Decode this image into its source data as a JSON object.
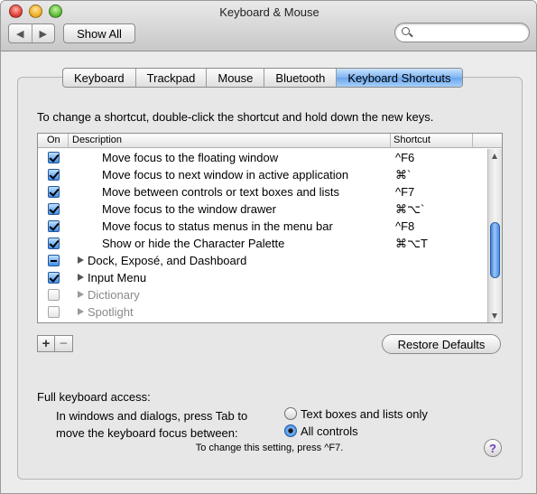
{
  "window": {
    "title": "Keyboard & Mouse"
  },
  "toolbar": {
    "back_glyph": "◀",
    "forward_glyph": "▶",
    "show_all_label": "Show All",
    "search_value": ""
  },
  "tabs": [
    {
      "label": "Keyboard",
      "active": false
    },
    {
      "label": "Trackpad",
      "active": false
    },
    {
      "label": "Mouse",
      "active": false
    },
    {
      "label": "Bluetooth",
      "active": false
    },
    {
      "label": "Keyboard Shortcuts",
      "active": true
    }
  ],
  "instruction": "To change a shortcut, double-click the shortcut and hold down the new keys.",
  "table": {
    "columns": {
      "on": "On",
      "description": "Description",
      "shortcut": "Shortcut"
    },
    "rows": [
      {
        "state": "checked",
        "description": "Move focus to the floating window",
        "shortcut": "^F6"
      },
      {
        "state": "checked",
        "description": "Move focus to next window in active application",
        "shortcut": "⌘`"
      },
      {
        "state": "checked",
        "description": "Move between controls or text boxes and lists",
        "shortcut": "^F7"
      },
      {
        "state": "checked",
        "description": "Move focus to the window drawer",
        "shortcut": "⌘⌥`"
      },
      {
        "state": "checked",
        "description": "Move focus to status menus in the menu bar",
        "shortcut": "^F8"
      },
      {
        "state": "checked",
        "description": "Show or hide the Character Palette",
        "shortcut": "⌘⌥T"
      },
      {
        "state": "mixed",
        "description": "Dock, Exposé, and Dashboard",
        "shortcut": ""
      },
      {
        "state": "checked",
        "description": "Input Menu",
        "shortcut": ""
      },
      {
        "state": "unchecked",
        "description": "Dictionary",
        "shortcut": ""
      },
      {
        "state": "unchecked",
        "description": "Spotlight",
        "shortcut": ""
      }
    ]
  },
  "buttons": {
    "add": "+",
    "remove": "−",
    "restore_defaults": "Restore Defaults",
    "help": "?"
  },
  "keyboard_access": {
    "heading": "Full keyboard access:",
    "description": "In windows and dialogs, press Tab to move the keyboard focus between:",
    "options": [
      {
        "label": "Text boxes and lists only",
        "selected": false
      },
      {
        "label": "All controls",
        "selected": true
      }
    ],
    "hint": "To change this setting, press ^F7."
  },
  "colors": {
    "selected_tab": "#7fb4f0",
    "checkbox_checked": "#3f8fe8",
    "scroll_thumb": "#4a8be0"
  },
  "scroll": {
    "thumb_position": 0.6,
    "visible_fraction": 0.38
  }
}
